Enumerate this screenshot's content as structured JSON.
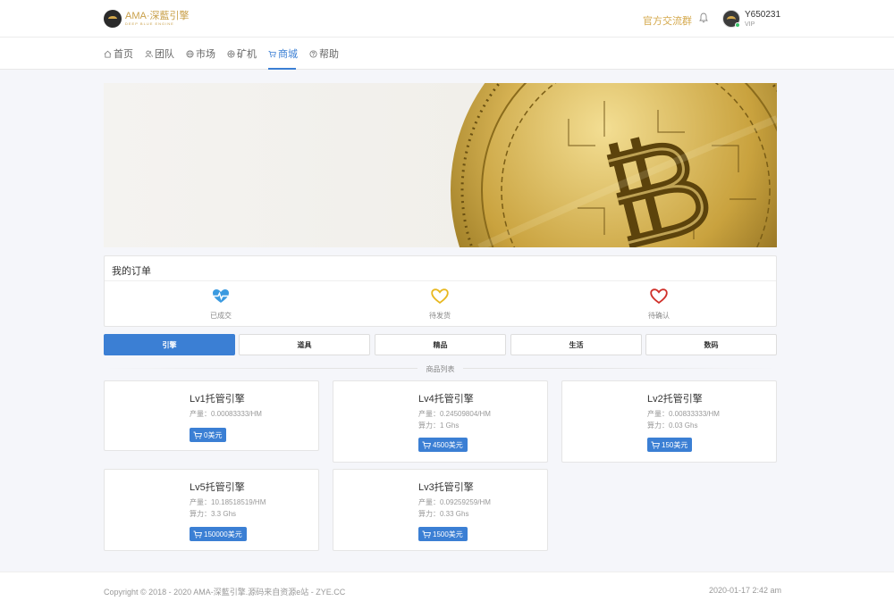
{
  "header": {
    "logo_main": "AMA·深藍引擎",
    "logo_sub": "DEEP BLUE ENGINE",
    "group_link": "官方交流群",
    "username": "Y650231",
    "user_level": "VIP",
    "bell_icon": "bell-icon"
  },
  "nav": {
    "items": [
      {
        "label": "首页",
        "icon": "home-icon"
      },
      {
        "label": "团队",
        "icon": "users-icon"
      },
      {
        "label": "市场",
        "icon": "globe-icon"
      },
      {
        "label": "矿机",
        "icon": "miner-icon"
      },
      {
        "label": "商城",
        "icon": "cart-icon",
        "active": true
      },
      {
        "label": "帮助",
        "icon": "help-icon"
      }
    ]
  },
  "orders": {
    "title": "我的订单",
    "items": [
      {
        "label": "已成交",
        "icon": "heartbeat-icon",
        "color": "#3b9ae0"
      },
      {
        "label": "待发货",
        "icon": "heart-outline-icon",
        "color": "#e8b820"
      },
      {
        "label": "待确认",
        "icon": "heart-outline-icon",
        "color": "#d0302a"
      }
    ]
  },
  "tabs": [
    {
      "label": "引擎",
      "active": true
    },
    {
      "label": "道具"
    },
    {
      "label": "精品"
    },
    {
      "label": "生活"
    },
    {
      "label": "数码"
    }
  ],
  "section_title": "商品列表",
  "products": [
    {
      "name": "Lv1托管引擎",
      "output": "产量：0.00083333/HM",
      "hashrate": "",
      "price": "0美元"
    },
    {
      "name": "Lv4托管引擎",
      "output": "产量：0.24509804/HM",
      "hashrate": "算力：1 Ghs",
      "price": "4500美元"
    },
    {
      "name": "Lv2托管引擎",
      "output": "产量：0.00833333/HM",
      "hashrate": "算力：0.03 Ghs",
      "price": "150美元"
    },
    {
      "name": "Lv5托管引擎",
      "output": "产量：10.18518519/HM",
      "hashrate": "算力：3.3 Ghs",
      "price": "150000美元"
    },
    {
      "name": "Lv3托管引擎",
      "output": "产量：0.09259259/HM",
      "hashrate": "算力：0.33 Ghs",
      "price": "1500美元"
    }
  ],
  "footer": {
    "copyright": "Copyright © 2018 - 2020 AMA-深藍引擎.源码来自资源e站 - ZYE.CC",
    "datetime": "2020-01-17 2:42 am"
  },
  "colors": {
    "accent": "#3b7fd4",
    "gold": "#d4a84b",
    "online": "#3cc46b"
  }
}
